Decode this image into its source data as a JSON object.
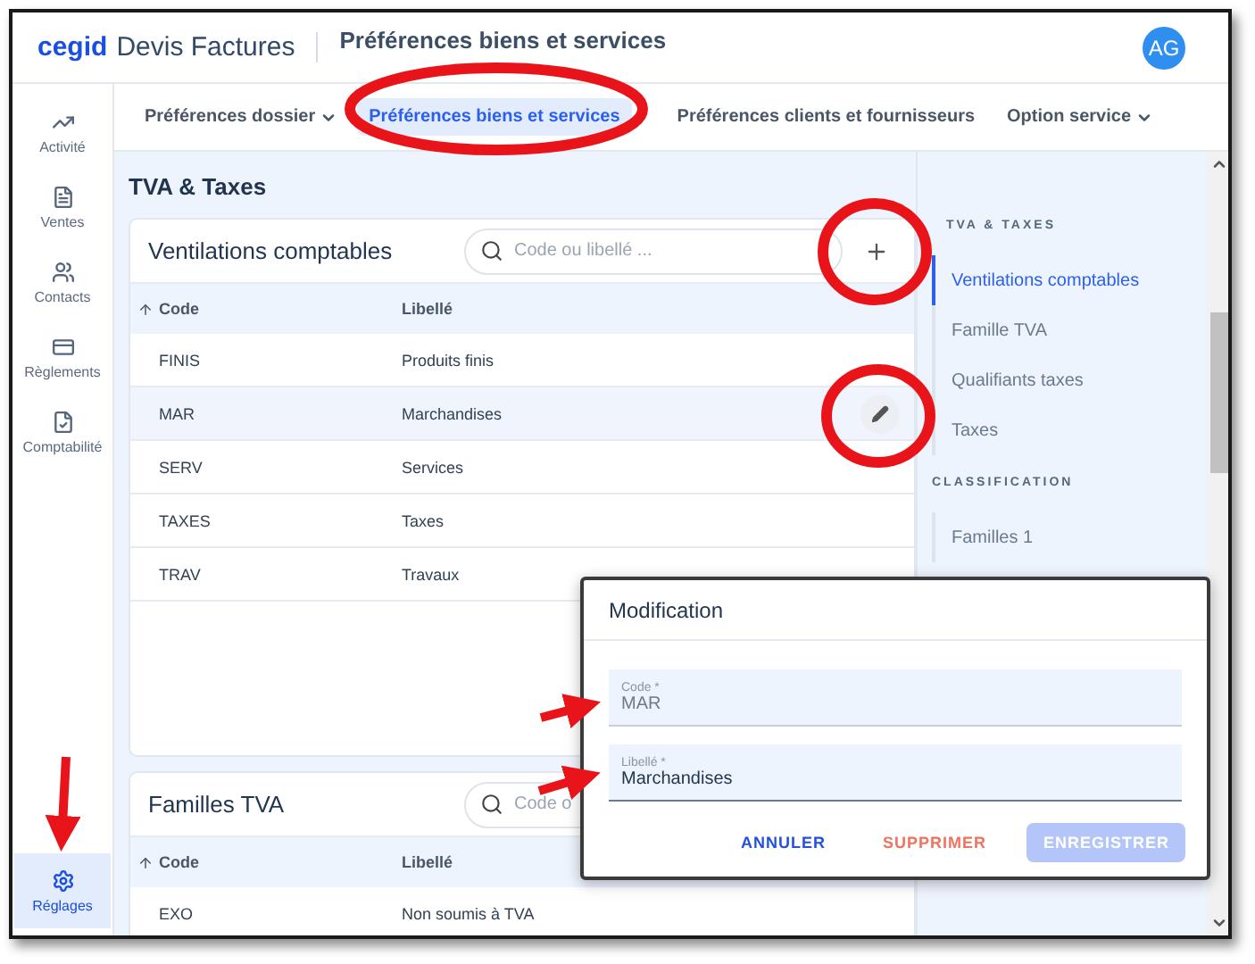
{
  "header": {
    "logo": "cegid",
    "app_name": "Devis Factures",
    "page_title": "Préférences biens et services",
    "avatar": "AG"
  },
  "sidebar": {
    "items": [
      {
        "label": "Activité",
        "kind": "activity",
        "selected": false
      },
      {
        "label": "Ventes",
        "kind": "sales",
        "selected": false
      },
      {
        "label": "Contacts",
        "kind": "contacts",
        "selected": false
      },
      {
        "label": "Règlements",
        "kind": "payments",
        "selected": false
      },
      {
        "label": "Comptabilité",
        "kind": "accounting",
        "selected": false
      }
    ],
    "bottom_item": {
      "label": "Réglages",
      "kind": "settings",
      "selected": true
    }
  },
  "tabs": [
    {
      "label": "Préférences dossier",
      "dropdown": true,
      "selected": false
    },
    {
      "label": "Préférences biens et services",
      "dropdown": false,
      "selected": true
    },
    {
      "label": "Préférences clients et fournisseurs",
      "dropdown": false,
      "selected": false
    },
    {
      "label": "Option service",
      "dropdown": true,
      "selected": false
    }
  ],
  "section_title": "TVA & Taxes",
  "cards": [
    {
      "title": "Ventilations comptables",
      "search_placeholder": "Code ou libellé ...",
      "add_button": true,
      "columns": [
        "Code",
        "Libellé"
      ],
      "rows": [
        {
          "code": "FINIS",
          "label": "Produits finis",
          "selected": false
        },
        {
          "code": "MAR",
          "label": "Marchandises",
          "selected": true
        },
        {
          "code": "SERV",
          "label": "Services",
          "selected": false
        },
        {
          "code": "TAXES",
          "label": "Taxes",
          "selected": false
        },
        {
          "code": "TRAV",
          "label": "Travaux",
          "selected": false
        }
      ]
    },
    {
      "title": "Familles TVA",
      "search_placeholder": "Code o",
      "columns": [
        "Code",
        "Libellé"
      ],
      "rows": [
        {
          "code": "EXO",
          "label": "Non soumis à TVA",
          "selected": false
        }
      ]
    }
  ],
  "side_nav": {
    "groups": [
      {
        "heading": "TVA & TAXES",
        "items": [
          {
            "label": "Ventilations comptables",
            "selected": true
          },
          {
            "label": "Famille TVA",
            "selected": false
          },
          {
            "label": "Qualifiants taxes",
            "selected": false
          },
          {
            "label": "Taxes",
            "selected": false
          }
        ]
      },
      {
        "heading": "CLASSIFICATION",
        "items": [
          {
            "label": "Familles 1",
            "selected": false
          }
        ]
      }
    ]
  },
  "dialog": {
    "title": "Modification",
    "fields": [
      {
        "label": "Code *",
        "value": "MAR",
        "disabled": true
      },
      {
        "label": "Libellé *",
        "value": "Marchandises",
        "disabled": false
      }
    ],
    "buttons": [
      {
        "label": "ANNULER",
        "kind": "cancel",
        "disabled": false
      },
      {
        "label": "SUPPRIMER",
        "kind": "delete",
        "disabled": false
      },
      {
        "label": "ENREGISTRER",
        "kind": "save",
        "disabled": true
      }
    ]
  }
}
